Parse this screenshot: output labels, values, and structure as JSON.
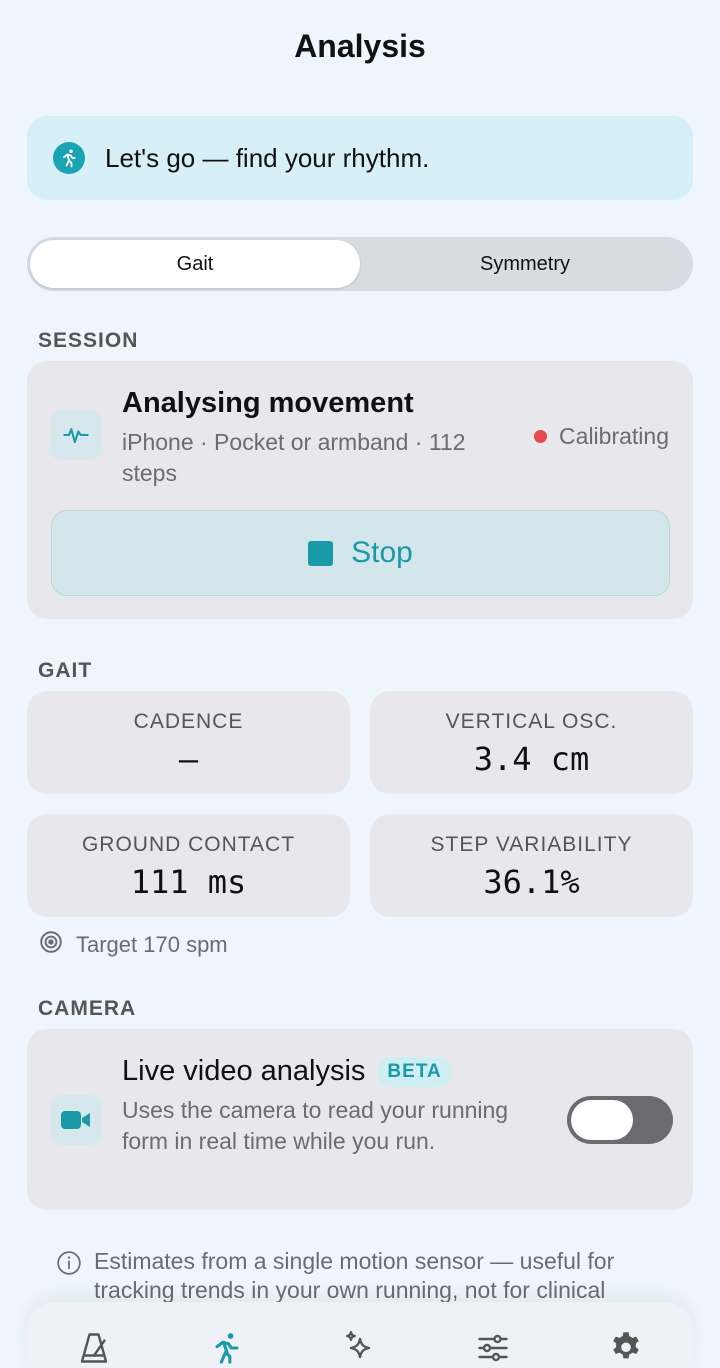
{
  "header": {
    "title": "Analysis"
  },
  "banner": {
    "text": "Let's go — find your rhythm.",
    "icon": "runner-icon"
  },
  "segmented": {
    "tabs": [
      {
        "label": "Gait",
        "active": true
      },
      {
        "label": "Symmetry",
        "active": false
      }
    ]
  },
  "session": {
    "section_label": "SESSION",
    "title": "Analysing movement",
    "subtitle": "iPhone · Pocket or armband · 112 steps",
    "status": "Calibrating",
    "stop_label": "Stop"
  },
  "gait": {
    "section_label": "GAIT",
    "metrics": [
      {
        "label": "CADENCE",
        "value": "—"
      },
      {
        "label": "VERTICAL OSC.",
        "value": "3.4 cm"
      },
      {
        "label": "GROUND CONTACT",
        "value": "111 ms"
      },
      {
        "label": "STEP VARIABILITY",
        "value": "36.1%"
      }
    ],
    "target": "Target 170 spm"
  },
  "camera": {
    "section_label": "CAMERA",
    "title": "Live video analysis",
    "badge": "BETA",
    "description": "Uses the camera to read your running form in real time while you run.",
    "toggle_on": false
  },
  "footnote": "Estimates from a single motion sensor — useful for tracking trends in your own running, not for clinical",
  "tabbar": {
    "items": [
      {
        "icon": "metronome-icon",
        "active": false
      },
      {
        "icon": "runner-icon",
        "active": true
      },
      {
        "icon": "sparkle-icon",
        "active": false
      },
      {
        "icon": "sliders-icon",
        "active": false
      },
      {
        "icon": "gear-icon",
        "active": false
      }
    ]
  },
  "colors": {
    "accent": "#1a9aa6",
    "status_red": "#e5484d",
    "background": "#eef5fd"
  }
}
